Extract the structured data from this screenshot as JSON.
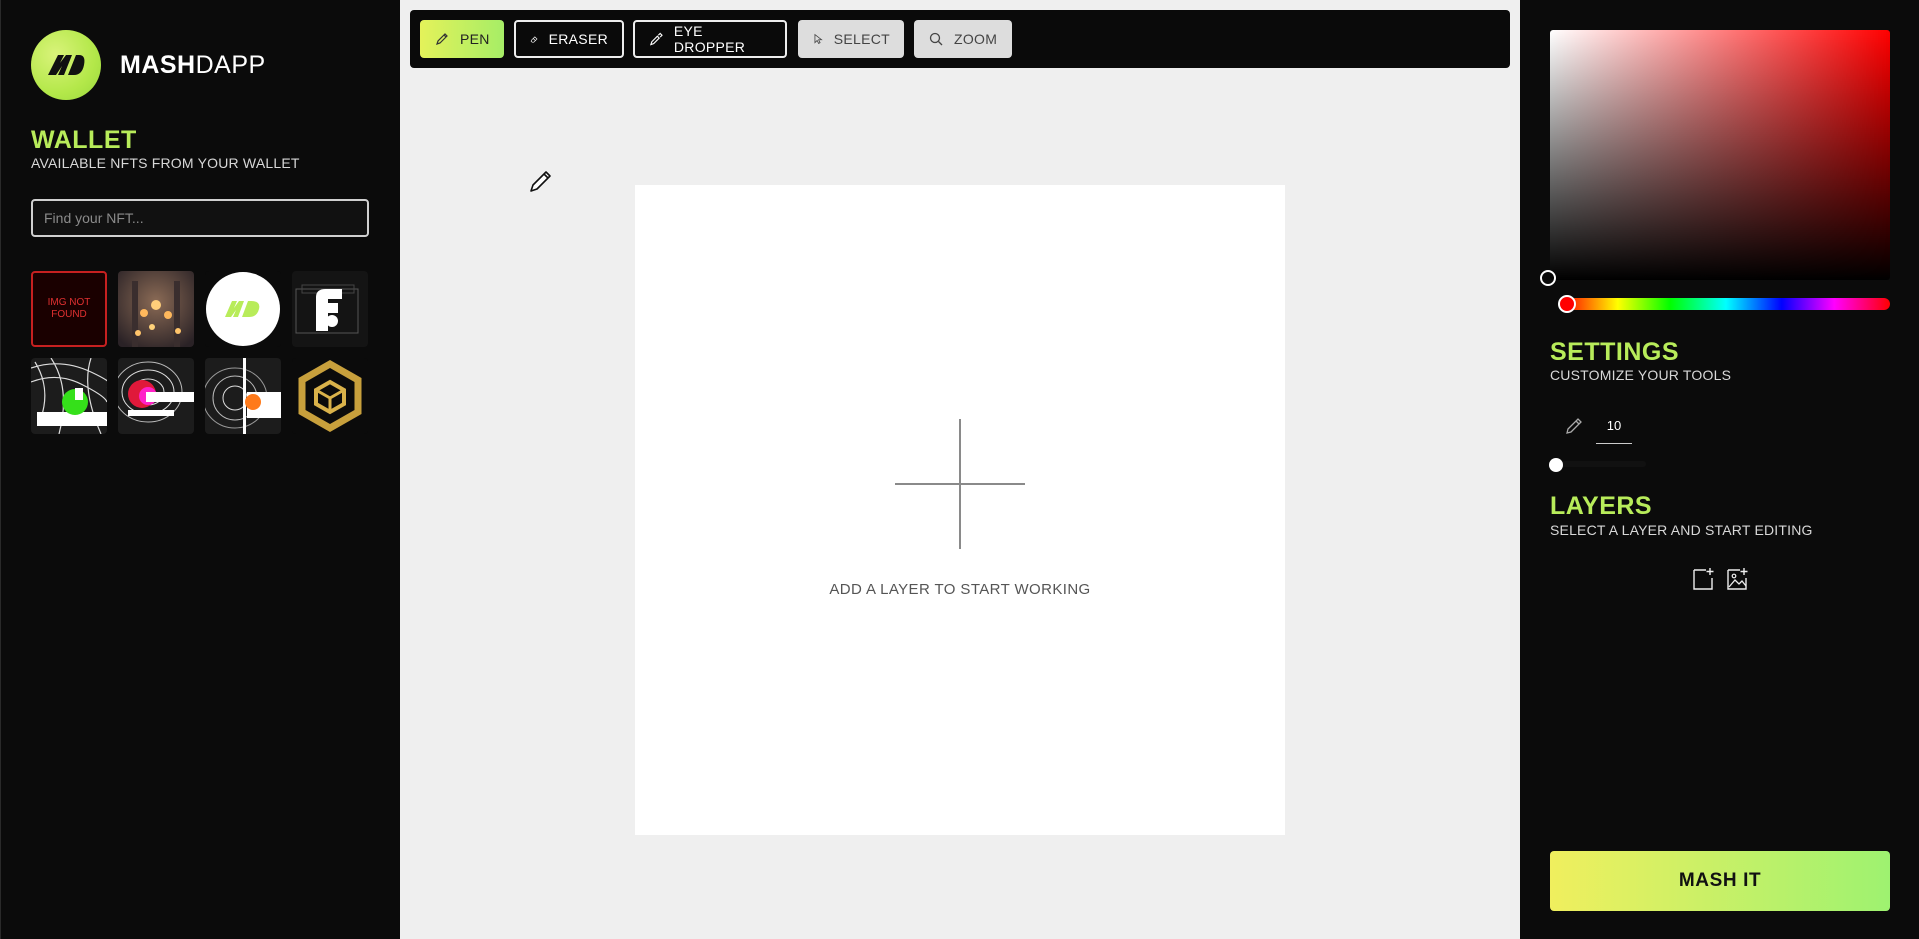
{
  "brand": {
    "bold": "MASH",
    "light": "DAPP"
  },
  "wallet": {
    "title": "WALLET",
    "subtitle": "AVAILABLE NFTS FROM YOUR WALLET",
    "search_placeholder": "Find your NFT...",
    "broken_label": "IMG NOT FOUND"
  },
  "toolbar": {
    "pen": "PEN",
    "eraser": "ERASER",
    "eye_dropper": "EYE DROPPER",
    "select": "SELECT",
    "zoom": "ZOOM"
  },
  "canvas": {
    "empty_text": "ADD A LAYER TO START WORKING"
  },
  "settings": {
    "title": "SETTINGS",
    "subtitle": "CUSTOMIZE YOUR TOOLS",
    "brush_size": "10"
  },
  "layers": {
    "title": "LAYERS",
    "subtitle": "SELECT A LAYER AND START EDITING"
  },
  "actions": {
    "mash": "MASH IT"
  },
  "colors": {
    "accent": "#b8ec5a",
    "selected_hue": "#ff0000"
  }
}
